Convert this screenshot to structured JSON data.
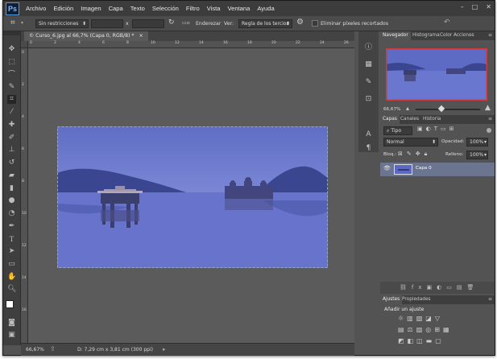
{
  "app": {
    "logo": "Ps"
  },
  "menu": {
    "items": [
      "Archivo",
      "Edición",
      "Imagen",
      "Capa",
      "Texto",
      "Selección",
      "Filtro",
      "Vista",
      "Ventana",
      "Ayuda"
    ]
  },
  "window_controls": {
    "minimize": "–",
    "maximize": "□",
    "close": "✕"
  },
  "options_bar": {
    "ratio_select": "Sin restricciones",
    "x_sep": "x",
    "enderezar_label": "Enderezar",
    "ver_label": "Ver:",
    "ver_select": "Regla de los tercios",
    "delete_pixels_label": "Eliminar píxeles recortados"
  },
  "document": {
    "tab_title": "© Curso_6.jpg al 66,7% (Capa 0, RGB/8) *",
    "tab_close": "×"
  },
  "rulers": {
    "h_ticks": [
      "0",
      "2",
      "4",
      "6",
      "8",
      "10",
      "12",
      "14",
      "16",
      "18",
      "20",
      "22",
      "24",
      "26"
    ],
    "v_ticks": [
      "0",
      "2",
      "4",
      "6",
      "8",
      "10",
      "12",
      "14",
      "16"
    ]
  },
  "status": {
    "zoom": "66,67%",
    "doc_info": "D: 7,29 cm x 3,81 cm (300 ppi)"
  },
  "navigator": {
    "tabs": [
      "Navegador",
      "Histograma",
      "Color",
      "Acciones"
    ],
    "zoom": "66,67%"
  },
  "layers": {
    "tabs": [
      "Capas",
      "Canales",
      "Historia"
    ],
    "filter_select": "Tipo",
    "blend_mode": "Normal",
    "opacity_label": "Opacidad:",
    "opacity_value": "100%",
    "lock_label": "Bloq.:",
    "fill_label": "Relleno:",
    "fill_value": "100%",
    "layer_name": "Capa 0"
  },
  "adjustments": {
    "tabs": [
      "Ajustes",
      "Propiedades"
    ],
    "title": "Añadir un ajuste"
  }
}
